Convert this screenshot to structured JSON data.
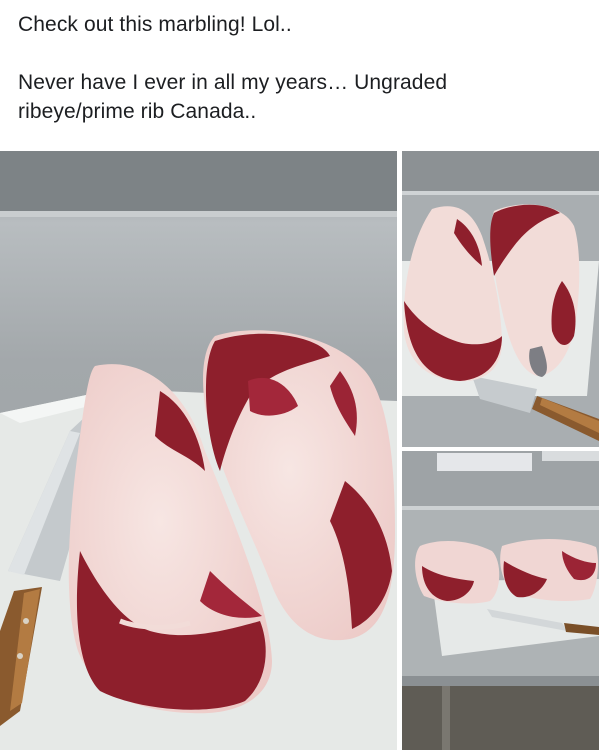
{
  "post": {
    "caption_line_1": "Check out this marbling! Lol..",
    "caption_line_2": "Never have I ever in all my years… Ungraded",
    "caption_line_3": "ribeye/prime rib Canada.."
  },
  "photos": [
    {
      "subject": "two ribeye steaks on cutting board with chef knife, close-up"
    },
    {
      "subject": "two ribeye steaks on cutting board with knife, angled view"
    },
    {
      "subject": "two ribeye roasts on cutting board with knife, wide view"
    }
  ],
  "colors": {
    "text": "#1c1e21",
    "steel": "#a7acb0",
    "board": "#e8ebe9",
    "meat_red": "#8e1f2c",
    "fat": "#f2dcd8"
  }
}
